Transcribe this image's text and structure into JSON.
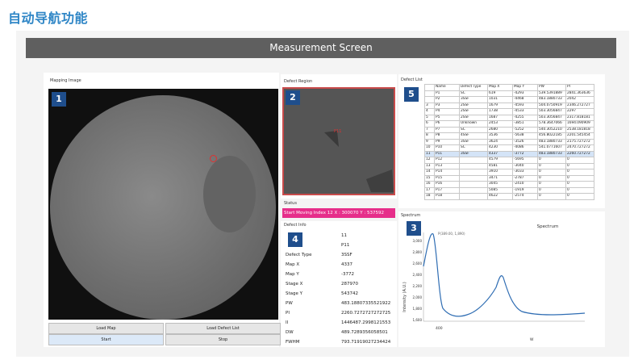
{
  "page_heading": "自动导航功能",
  "window": {
    "title": "Measurement Screen"
  },
  "mapping": {
    "label": "Mapping Image",
    "badge": "1",
    "buttons": {
      "load_map": "Load Map",
      "load_defect_list": "Load Defect List",
      "start": "Start",
      "stop": "Stop"
    }
  },
  "defect_region": {
    "label": "Defect Region",
    "badge": "2",
    "marker": "P11"
  },
  "status": {
    "label": "Status",
    "text": "Start Moving Index 12 X : 300070 Y : 537592"
  },
  "defect_info": {
    "label": "Defect Info",
    "badge": "4",
    "index": "11",
    "name": "P11",
    "rows": [
      {
        "key": "Defect Type",
        "value": "3SSF"
      },
      {
        "key": "Map X",
        "value": "4337"
      },
      {
        "key": "Map Y",
        "value": "-3772"
      },
      {
        "key": "Stage X",
        "value": "287970"
      },
      {
        "key": "Stage Y",
        "value": "543742"
      },
      {
        "key": "PW",
        "value": "483.18807335521922"
      },
      {
        "key": "PI",
        "value": "2260.7272727272725"
      },
      {
        "key": "II",
        "value": "1446487.2998121553"
      },
      {
        "key": "DW",
        "value": "489.7289356058501"
      },
      {
        "key": "FWHM",
        "value": "793.71919027234424"
      }
    ]
  },
  "defect_list": {
    "label": "Defect List",
    "badge": "5",
    "columns": [
      "",
      "Name",
      "Defect Type",
      "Map X",
      "Map Y",
      "PW",
      "PI"
    ],
    "rows": [
      [
        "",
        "P1",
        "SC",
        "619",
        "-4293",
        "539.5391889",
        "2841.363636"
      ],
      [
        "",
        "P2",
        "3SSF",
        "1031",
        "-4468",
        "483.1880733",
        "2042"
      ],
      [
        "3",
        "P3",
        "2SSF",
        "1679",
        "-4593",
        "504.0750919",
        "2346.272727"
      ],
      [
        "4",
        "P4",
        "2SSF",
        "1738",
        "-4533",
        "503.3056847",
        "2297"
      ],
      [
        "5",
        "P5",
        "2SSF",
        "1687",
        "-4255",
        "503.3056847",
        "2317.818181"
      ],
      [
        "6",
        "P6",
        "Unknown",
        "2453",
        "-3851",
        "578.3647066",
        "1694.090909"
      ],
      [
        "7",
        "P7",
        "SC",
        "2680",
        "-5252",
        "540.3052210",
        "2538.181818"
      ],
      [
        "8",
        "P8",
        "4SSF",
        "3536",
        "-5638",
        "456.8022185",
        "2201.545454"
      ],
      [
        "9",
        "P9",
        "3SSF",
        "3624",
        "-3526",
        "483.1880733",
        "2175.727272"
      ],
      [
        "10",
        "P10",
        "SC",
        "4230",
        "-4086",
        "541.0771607",
        "2470.727272"
      ],
      [
        "11",
        "P11",
        "3SSF",
        "4337",
        "-3772",
        "483.1880733",
        "2260.727272"
      ],
      [
        "12",
        "P12",
        "",
        "4579",
        "-5695",
        "0",
        "0"
      ],
      [
        "13",
        "P13",
        "",
        "4581",
        "-3040",
        "0",
        "0"
      ],
      [
        "14",
        "P14",
        "",
        "3910",
        "-3033",
        "0",
        "0"
      ],
      [
        "15",
        "P15",
        "",
        "3471",
        "-2787",
        "0",
        "0"
      ],
      [
        "16",
        "P16",
        "",
        "3045",
        "-2410",
        "0",
        "0"
      ],
      [
        "17",
        "P17",
        "",
        "5085",
        "-1919",
        "0",
        "0"
      ],
      [
        "18",
        "P18",
        "",
        "4622",
        "-2574",
        "0",
        "0"
      ]
    ]
  },
  "spectrum": {
    "label": "Spectrum",
    "badge": "3",
    "chart_title": "Spectrum",
    "ylabel": "Intensity (A.U.)",
    "peak_annotation": "P(389.00, 1,890)",
    "y_ticks": [
      "3,000",
      "2,800",
      "2,600",
      "2,400",
      "2,200",
      "2,000",
      "1,800",
      "1,600"
    ],
    "x_ticks": [
      "400",
      "W"
    ]
  },
  "colors": {
    "accent": "#2f86c6",
    "status": "#e62e8a",
    "badge": "#1f4e8c",
    "title_bar": "#5f5f5f"
  }
}
